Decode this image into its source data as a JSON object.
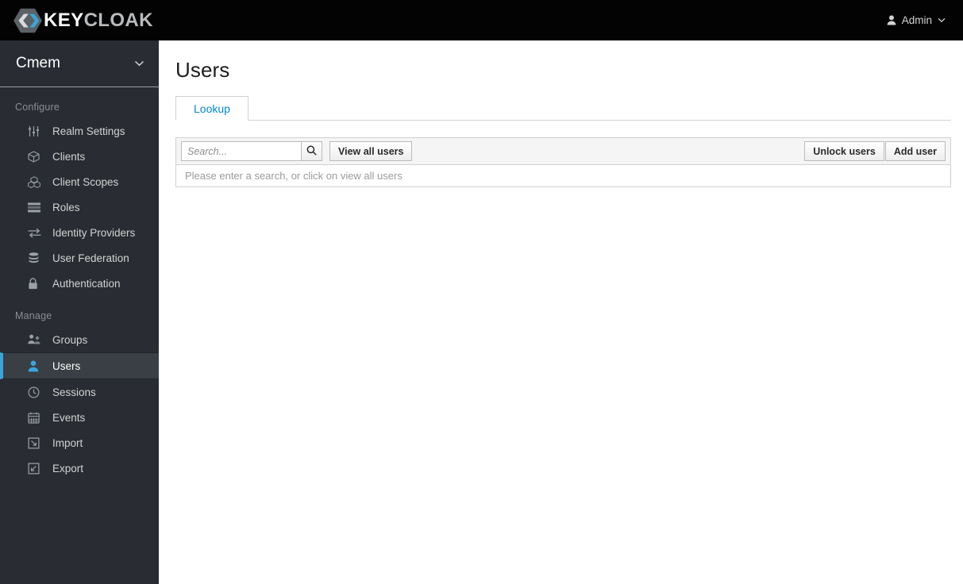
{
  "masthead": {
    "brand": {
      "text_primary": "KEY",
      "text_secondary": "CLOAK",
      "logo_icon": "keycloak-hexagon-logo"
    },
    "user": {
      "label": "Admin",
      "icon": "user-icon",
      "caret_icon": "chevron-down-icon"
    }
  },
  "sidebar": {
    "realm": {
      "name": "Cmem",
      "caret_icon": "chevron-down-icon"
    },
    "sections": [
      {
        "title": "Configure",
        "items": [
          {
            "label": "Realm Settings",
            "icon": "sliders-icon",
            "active": false
          },
          {
            "label": "Clients",
            "icon": "cube-icon",
            "active": false
          },
          {
            "label": "Client Scopes",
            "icon": "cubes-icon",
            "active": false
          },
          {
            "label": "Roles",
            "icon": "list-bars-icon",
            "active": false
          },
          {
            "label": "Identity Providers",
            "icon": "exchange-arrows-icon",
            "active": false
          },
          {
            "label": "User Federation",
            "icon": "database-icon",
            "active": false
          },
          {
            "label": "Authentication",
            "icon": "lock-icon",
            "active": false
          }
        ]
      },
      {
        "title": "Manage",
        "items": [
          {
            "label": "Groups",
            "icon": "users-group-icon",
            "active": false
          },
          {
            "label": "Users",
            "icon": "user-icon",
            "active": true
          },
          {
            "label": "Sessions",
            "icon": "clock-icon",
            "active": false
          },
          {
            "label": "Events",
            "icon": "calendar-icon",
            "active": false
          },
          {
            "label": "Import",
            "icon": "import-arrow-icon",
            "active": false
          },
          {
            "label": "Export",
            "icon": "export-arrow-icon",
            "active": false
          }
        ]
      }
    ]
  },
  "main": {
    "title": "Users",
    "tabs": [
      {
        "label": "Lookup",
        "active": true
      }
    ],
    "toolbar": {
      "search_value": "",
      "search_placeholder": "Search...",
      "search_icon": "search-icon",
      "view_all_label": "View all users",
      "unlock_users_label": "Unlock users",
      "add_user_label": "Add user"
    },
    "result_message": "Please enter a search, or click on view all users"
  },
  "colors": {
    "masthead_bg": "#030303",
    "sidebar_bg": "#292d33",
    "active_accent": "#39a5dc",
    "link_blue": "#0088ce",
    "panel_bg": "#f5f5f5",
    "brand_secondary": "#b8bbbe"
  }
}
